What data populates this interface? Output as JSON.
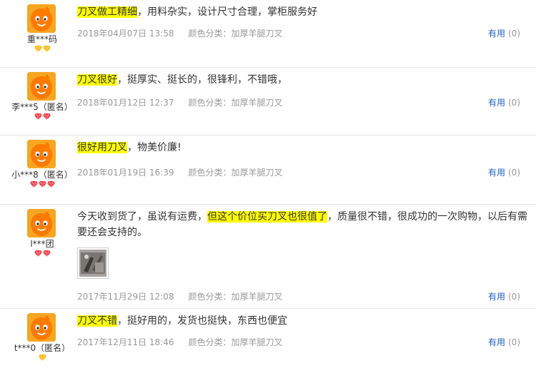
{
  "reviews": [
    {
      "user": "重***码",
      "badges": 2,
      "badge_color": "#f7b500",
      "content_highlight": "刀叉做工精细",
      "content_rest": "，用料杂实，设计尺寸合理，掌柜服务好",
      "date": "2018年04月07日 13:58",
      "color_label": "颜色分类：加厚羊腿刀叉",
      "useful_label": "有用",
      "useful_count": "(0)"
    },
    {
      "user": "李***5（匿名）",
      "badges": 2,
      "badge_color": "#e8323c",
      "content_highlight": "刀叉很好",
      "content_rest": "，挺厚实、挺长的，很锋利，不错哦，",
      "date": "2018年01月12日 12:37",
      "color_label": "颜色分类：加厚羊腿刀叉",
      "useful_label": "有用",
      "useful_count": "(0)"
    },
    {
      "user": "小***8（匿名）",
      "badges": 3,
      "badge_color": "#e8323c",
      "content_highlight": "很好用刀叉",
      "content_rest": "，物美价廉!",
      "date": "2018年01月19日 16:39",
      "color_label": "颜色分类：加厚羊腿刀叉",
      "useful_label": "有用",
      "useful_count": "(0)"
    },
    {
      "user": "l***团",
      "badges": 2,
      "badge_color": "#e8323c",
      "content_before": "今天收到货了，虽说有运费，",
      "content_highlight": "但这个价位买刀叉也很值了",
      "content_rest": "，质量很不错，很成功的一次购物，以后有需要还会支持的。",
      "date": "2017年11月29日 12:08",
      "color_label": "颜色分类：加厚羊腿刀叉",
      "useful_label": "有用",
      "useful_count": "(0)"
    },
    {
      "user": "t***0（匿名）",
      "badges": 1,
      "badge_color": "#f7b500",
      "content_highlight": "刀叉不错",
      "content_rest": "，挺好用的，发货也挺快，东西也便宜",
      "date": "2017年12月11日 18:46",
      "color_label": "颜色分类：加厚羊腿刀叉",
      "useful_label": "有用",
      "useful_count": "(0)"
    }
  ]
}
